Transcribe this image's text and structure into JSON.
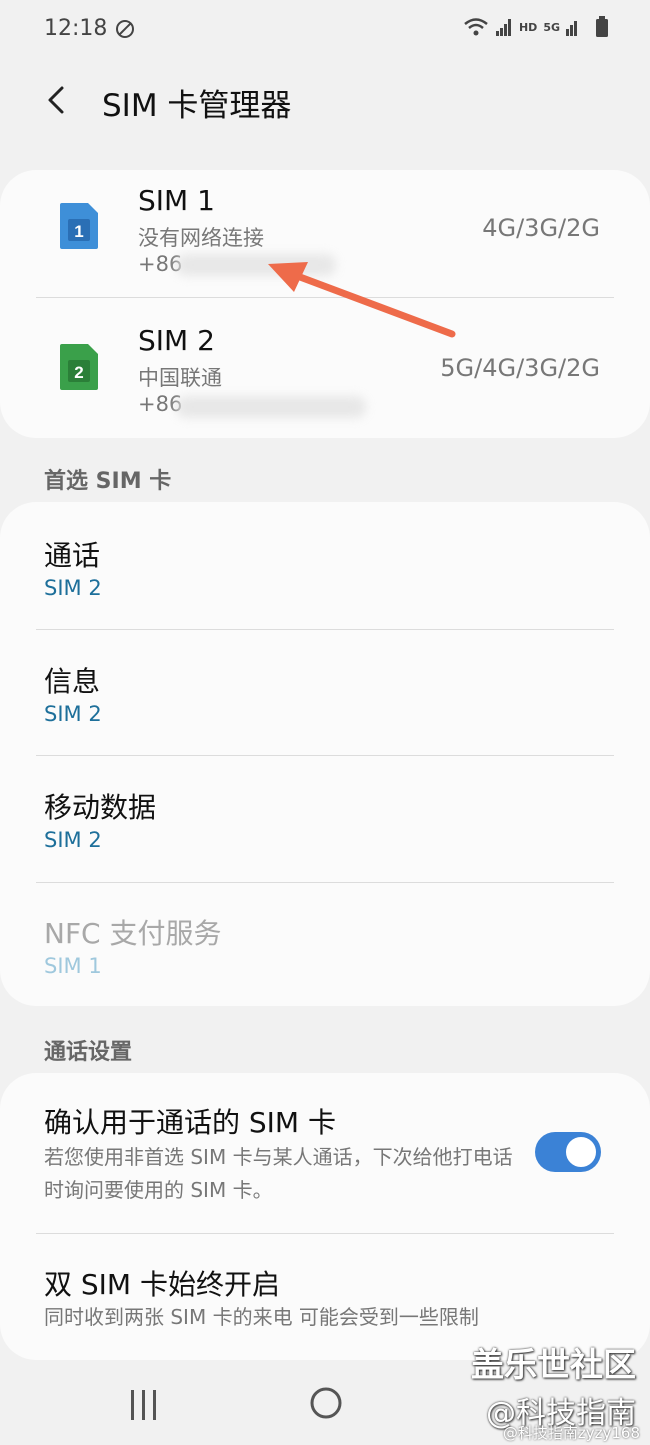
{
  "status": {
    "time": "12:18",
    "hd_label": "HD",
    "net_label": "5G",
    "icons": [
      "dnd-icon",
      "wifi-icon",
      "signal-icon",
      "battery-icon"
    ]
  },
  "header": {
    "title": "SIM 卡管理器",
    "back_icon": "back-arrow-icon"
  },
  "sims": [
    {
      "name": "SIM 1",
      "status": "没有网络连接",
      "number_prefix": "+86",
      "network": "4G/3G/2G",
      "badge": "1",
      "color": "#3e8fd8"
    },
    {
      "name": "SIM 2",
      "status": "中国联通",
      "number_prefix": "+86",
      "network": "5G/4G/3G/2G",
      "badge": "2",
      "color": "#3aa04a"
    }
  ],
  "preferred": {
    "header": "首选 SIM 卡",
    "items": [
      {
        "title": "通话",
        "value": "SIM 2"
      },
      {
        "title": "信息",
        "value": "SIM 2"
      },
      {
        "title": "移动数据",
        "value": "SIM 2"
      },
      {
        "title": "NFC 支付服务",
        "value": "SIM 1"
      }
    ]
  },
  "call_settings": {
    "header": "通话设置",
    "confirm": {
      "title": "确认用于通话的 SIM 卡",
      "desc": "若您使用非首选 SIM 卡与某人通话，下次给他打电话时询问要使用的 SIM 卡。",
      "enabled": true
    },
    "dual_on": {
      "title": "双 SIM 卡始终开启",
      "desc": "同时收到两张 SIM 卡的来电 可能会受到一些限制"
    }
  },
  "watermark": {
    "line1": "盖乐世社区",
    "line2": "@科技指南",
    "line3": "@科技指南zyzy168"
  },
  "colors": {
    "accent": "#3b82d6",
    "value_blue": "#1d6f9a",
    "arrow": "#ee6b4a"
  }
}
